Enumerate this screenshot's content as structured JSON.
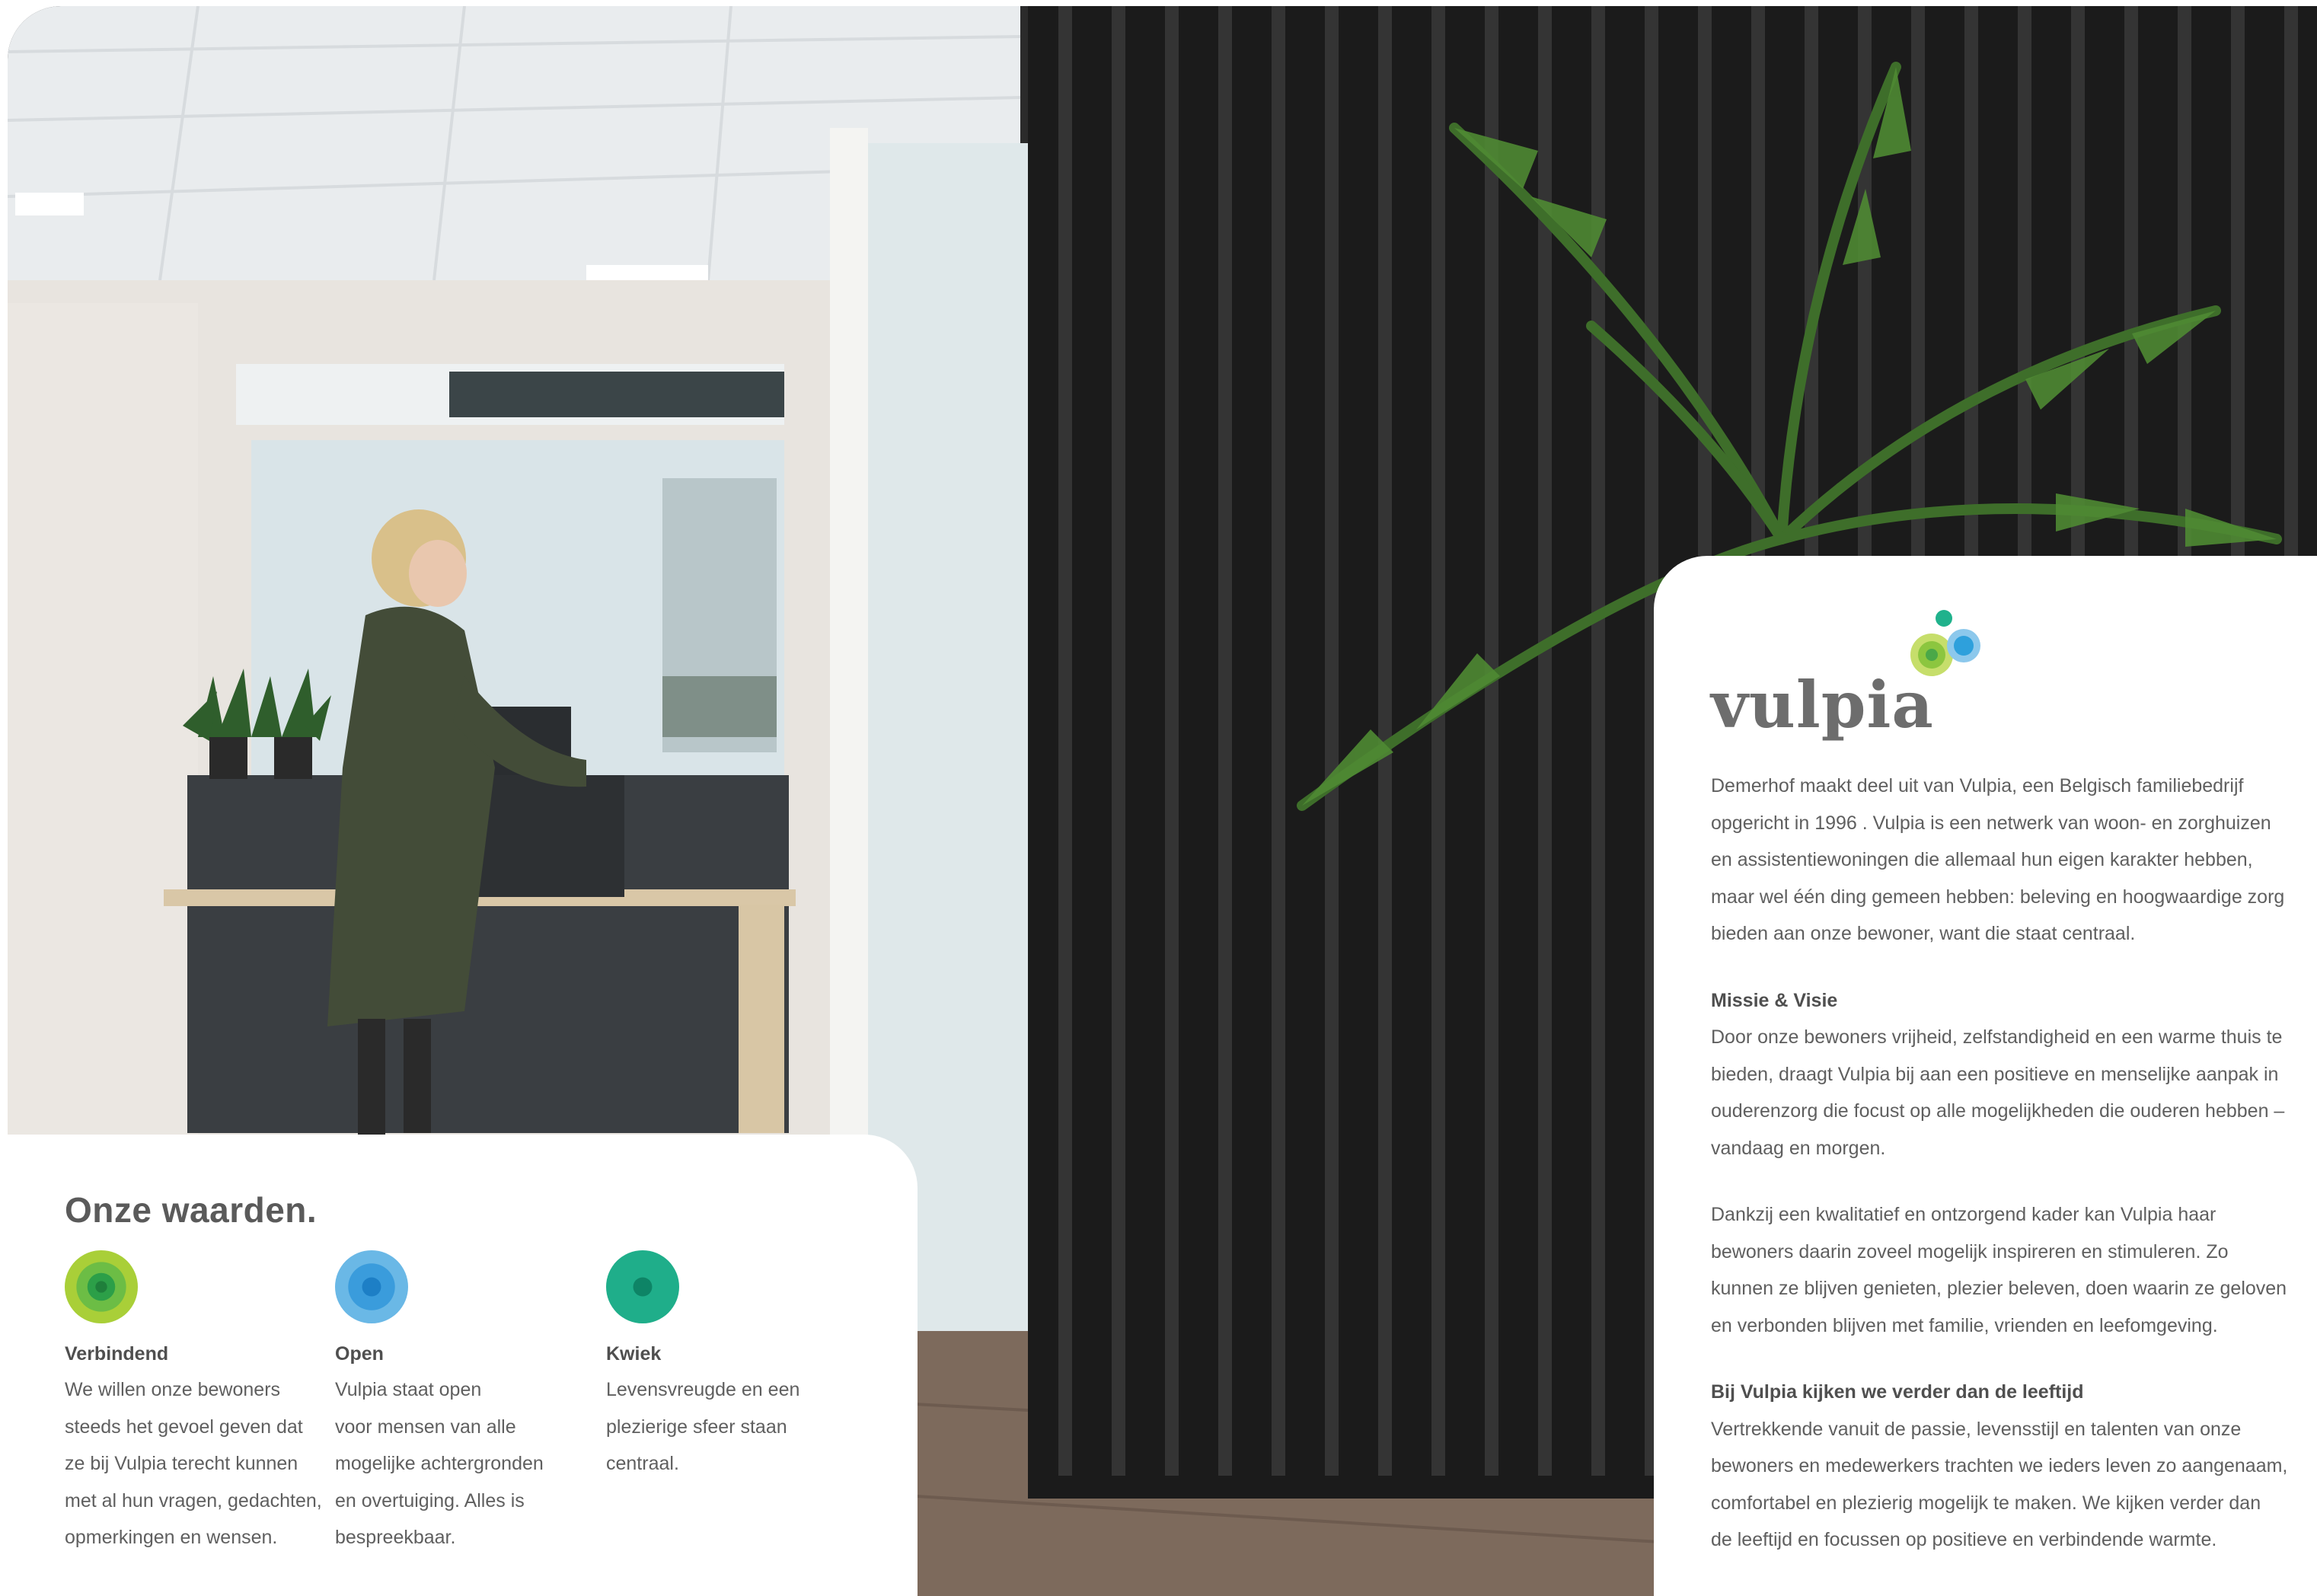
{
  "values": {
    "title": "Onze waarden.",
    "items": [
      {
        "name": "Verbindend",
        "text": "We willen onze bewoners\nsteeds het gevoel geven dat\nze bij Vulpia terecht kunnen\nmet al hun vragen, gedachten,\nopmerkingen en wensen.",
        "icon": "green-concentric-circle-icon",
        "colors": [
          "#a9cf38",
          "#6cbd45",
          "#2c9f48"
        ]
      },
      {
        "name": "Open",
        "text": "Vulpia staat open\nvoor mensen van alle\nmogelijke achtergronden\nen overtuiging. Alles is\nbespreekbaar.",
        "icon": "blue-concentric-circle-icon",
        "colors": [
          "#6ab8e6",
          "#3a9cdc",
          "#1d7fc6"
        ]
      },
      {
        "name": "Kwiek",
        "text": "Levensvreugde en een\nplezierige sfeer staan\ncentraal.",
        "icon": "teal-concentric-circle-icon",
        "colors": [
          "#1fae8a",
          "#159a78",
          "#0e8466"
        ]
      }
    ]
  },
  "brand": {
    "name": "vulpia",
    "dot_colors": [
      "#20b28c",
      "#8cc63f",
      "#2ea0dc"
    ]
  },
  "info": {
    "intro": "Demerhof maakt deel uit van Vulpia, een Belgisch familiebedrijf\nopgericht in 1996 . Vulpia is een netwerk van woon- en zorghuizen\nen assistentiewoningen die allemaal hun eigen karakter hebben,\nmaar wel één ding gemeen hebben: beleving en hoogwaardige zorg\nbieden aan onze bewoner, want die staat centraal.",
    "mission_heading": "Missie & Visie",
    "mission_text": "Door onze bewoners vrijheid, zelfstandigheid en een warme thuis te\nbieden, draagt Vulpia bij aan een positieve en menselijke aanpak in\nouderenzorg die focust op alle mogelijkheden die ouderen hebben –\nvandaag en morgen.",
    "framework_text": "Dankzij een kwalitatief en ontzorgend kader kan Vulpia haar\nbewoners daarin zoveel mogelijk inspireren en stimuleren. Zo\nkunnen ze blijven genieten, plezier beleven, doen waarin ze geloven\nen verbonden blijven met familie, vrienden en leefomgeving.",
    "age_heading": "Bij Vulpia kijken we verder dan de leeftijd",
    "age_text": "Vertrekkende vanuit de passie, levensstijl en talenten van onze\nbewoners en medewerkers trachten we ieders leven zo aangenaam,\ncomfortabel en plezierig mogelijk te maken. We kijken verder dan\nde leeftijd en focussen op positieve en verbindende warmte."
  }
}
